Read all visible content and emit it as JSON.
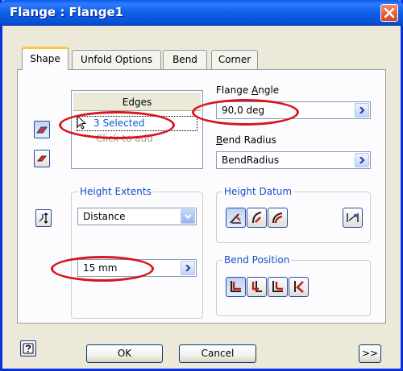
{
  "window": {
    "title": "Flange : Flange1"
  },
  "tabs": [
    {
      "label": "Shape"
    },
    {
      "label": "Unfold Options"
    },
    {
      "label": "Bend"
    },
    {
      "label": "Corner"
    }
  ],
  "edges": {
    "header": "Edges",
    "selected": "3 Selected",
    "hint": "Click to add"
  },
  "flange_angle": {
    "label_pre": "Flange ",
    "label_key": "A",
    "label_post": "ngle",
    "value": "90,0 deg"
  },
  "bend_radius": {
    "label_key": "B",
    "label_post": "end Radius",
    "value": "BendRadius"
  },
  "height_extents": {
    "title": "Height Extents",
    "mode": "Distance",
    "value": "15 mm"
  },
  "height_datum": {
    "title": "Height Datum"
  },
  "bend_position": {
    "title": "Bend Position"
  },
  "footer": {
    "help": "?",
    "ok": "OK",
    "cancel": "Cancel",
    "more": ">>"
  },
  "colors": {
    "title_bar": "#0A5BEA",
    "annotation": "#D8141C",
    "group_title": "#1550C6",
    "selected_text": "#0A5BD6"
  }
}
